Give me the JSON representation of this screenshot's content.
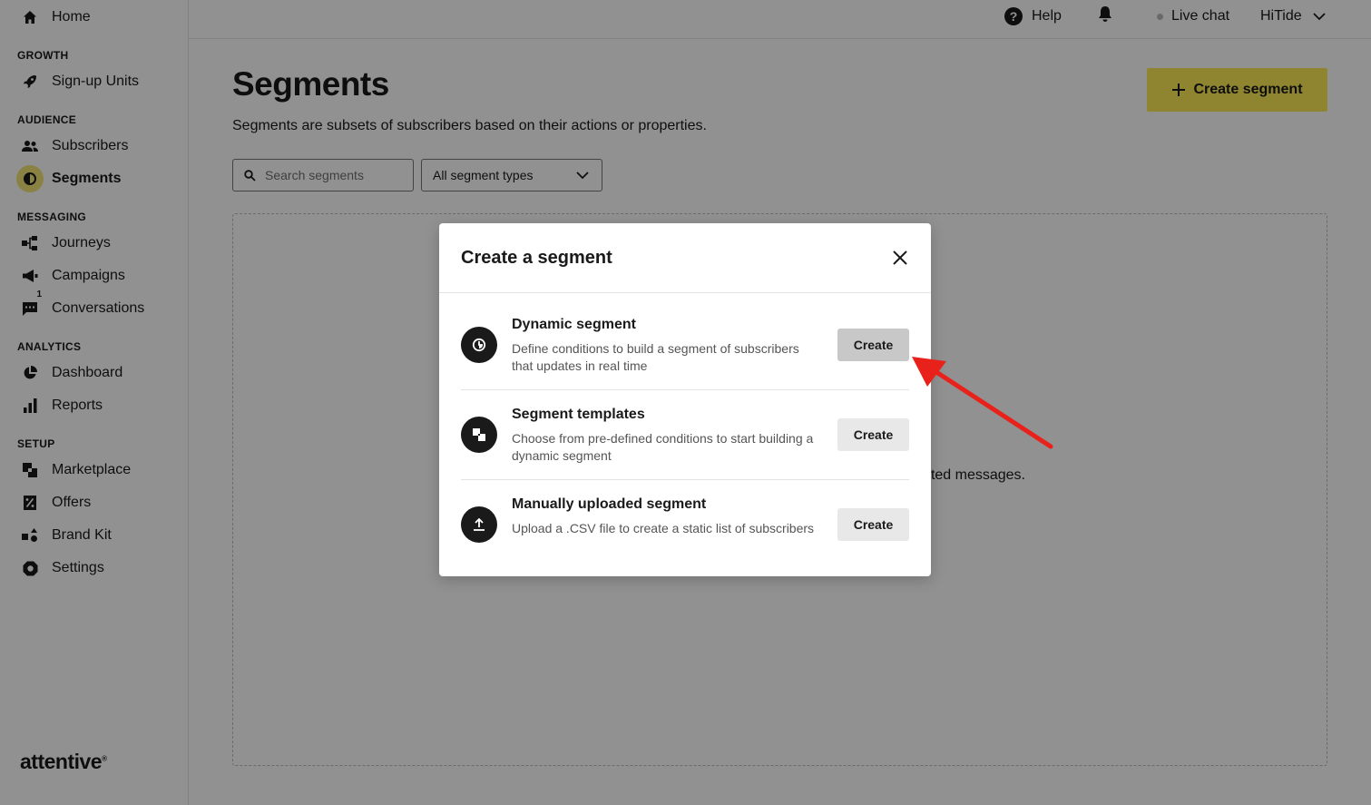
{
  "sidebar": {
    "home": "Home",
    "sections": [
      {
        "label": "GROWTH",
        "items": [
          {
            "label": "Sign-up Units",
            "icon": "rocket-icon"
          }
        ]
      },
      {
        "label": "AUDIENCE",
        "items": [
          {
            "label": "Subscribers",
            "icon": "users-icon"
          },
          {
            "label": "Segments",
            "icon": "segments-icon",
            "active": true
          }
        ]
      },
      {
        "label": "MESSAGING",
        "items": [
          {
            "label": "Journeys",
            "icon": "journeys-icon"
          },
          {
            "label": "Campaigns",
            "icon": "megaphone-icon"
          },
          {
            "label": "Conversations",
            "icon": "chat-icon",
            "badge": "1"
          }
        ]
      },
      {
        "label": "ANALYTICS",
        "items": [
          {
            "label": "Dashboard",
            "icon": "pie-chart-icon"
          },
          {
            "label": "Reports",
            "icon": "bar-chart-icon"
          }
        ]
      },
      {
        "label": "SETUP",
        "items": [
          {
            "label": "Marketplace",
            "icon": "marketplace-icon"
          },
          {
            "label": "Offers",
            "icon": "offers-icon"
          },
          {
            "label": "Brand Kit",
            "icon": "brand-kit-icon"
          },
          {
            "label": "Settings",
            "icon": "gear-icon"
          }
        ]
      }
    ],
    "logo": "attentive"
  },
  "topbar": {
    "help": "Help",
    "live_chat": "Live chat",
    "account": "HiTide"
  },
  "main": {
    "title": "Segments",
    "description": "Segments are subsets of subscribers based on their actions or properties.",
    "create_button": "Create segment",
    "search_placeholder": "Search segments",
    "filter_selected": "All segment types",
    "empty_text": "ted messages."
  },
  "modal": {
    "title": "Create a segment",
    "options": [
      {
        "title": "Dynamic segment",
        "description": "Define conditions to build a segment of subscribers that updates in real time",
        "button": "Create",
        "icon": "clock-pie-icon"
      },
      {
        "title": "Segment templates",
        "description": "Choose from pre-defined conditions to start building a dynamic segment",
        "button": "Create",
        "icon": "template-icon"
      },
      {
        "title": "Manually uploaded segment",
        "description": "Upload a .CSV file to create a static list of subscribers",
        "button": "Create",
        "icon": "upload-icon"
      }
    ]
  },
  "colors": {
    "accent": "#fbe953",
    "annotation_arrow": "#e8221b"
  }
}
